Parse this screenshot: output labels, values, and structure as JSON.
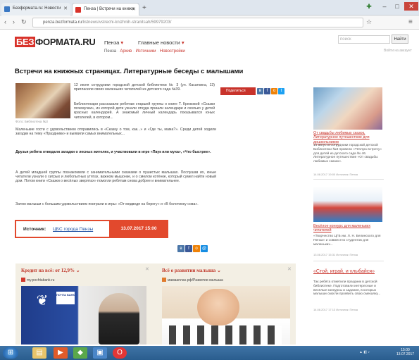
{
  "browser": {
    "tabs": [
      {
        "label": "Безформата.ru: Новости",
        "favicon_color": "#3a78c4"
      },
      {
        "label": "Пенза | Встречи на книжн",
        "favicon_color": "#d8322a"
      }
    ],
    "new_tab": "+",
    "address": {
      "domain": "penza.bezformata.ru",
      "path": "/listnews/vstrechi-knizhnih-stranitsah/59979203/"
    },
    "window_controls": {
      "minimize": "–",
      "maximize": "□",
      "close": "✕"
    }
  },
  "site": {
    "logo_red": "БЕЗ",
    "logo_rest": "ФОРМАТА.RU",
    "city": "Пенза",
    "main_news": "Главные новости",
    "search_placeholder": "поиск",
    "search_button": "Найти",
    "login": "Войти на аккаунт",
    "breadcrumbs": [
      "Пенза",
      "Архив",
      "Источники",
      "Новостройки"
    ]
  },
  "article": {
    "title": "Встречи на книжных страницах. Литературные беседы с малышами",
    "photo_caption": "Фото: Библиотека №3",
    "p1": "12 июля сотрудники городской детской библиотеки № 3 (ул. Касаткина, 13) пригласили своих маленьких читателей из детского сада №39.",
    "p2": "Библиотекари рассказали ребятам старшей группы о книге Т. Крюковой «Сказки почемучки», из которой дети узнали откуда пришли календари и сколько у детей красных календарей. А знакомый личный календарь показывался юных читателей, в котором...",
    "p3": "Маленькие гости с удовольствием отправились в «Сказку о том, как...» и «Где ты, мама?». Среди детей ходили загадки на тему «Праздники» и выявили самых внимательных...",
    "p4_bold": "Друзья ребята отведали загадки о лесных жителях, и участвовали в игре «Паук или муха», «Что быстрее».",
    "p5": "А детей младшей группы познакомили с занимательными сказками о пушистых малышах. Послушав их, юные читатели узнали о хитрых и любопытных утятах, важном мышонке, и о смелом котёнке, который сумел найти новый дом. Потом книги «Сказки о весёлых зверятах» помогли ребятам снова добрее и внимательнее.",
    "p6": "Затем малыши с большим удовольствием поиграли в игры: «От медведя на берегу» и «В болотинку сова».",
    "share_label": "Поделиться",
    "source_label": "Источник:",
    "source_link": "ЦБС города Пензы",
    "source_date": "13.07.2017  15:00"
  },
  "ads": [
    {
      "title": "Кредит на всё: от 12,9%",
      "source": "my.pochtabank.ru",
      "bank_label": "ПОЧТА БАНК"
    },
    {
      "title": "Всё о развитии малыша",
      "source": "мамааплан.рф/Развитие-малыша"
    }
  ],
  "sidebar": [
    {
      "link": "От свадьбы любимых сказок, Литературное путешествие для дошкольников",
      "text": "14 августа сотрудники городской детской Библиотеки №3 провели «Тёплую встречу» для детей из детского сада № 46. Литературное путешествие «От свадьбы любимых сказок».",
      "meta": "14.08.2017 19:00 Источник: Пенза"
    },
    {
      "link": "Весёлое конкурс для маленьких читателей",
      "text": "«Творчество ЦГБ им. Л. Н. Белинского для Пенза» и совместно студентов для маленьких...",
      "meta": "13.08.2017 15:31 Источник: Пенза"
    },
    {
      "link": "«Стой, играй, и улыбайся»",
      "text": "Так ребята отметили праздник в детской библиотеке. Подготовили интересные и весёлые конкурсы и задания, в которых малыши смогли проявить свою смекалку...",
      "meta": "14.08.2017 17:13 Источник: Пенза"
    }
  ],
  "taskbar": {
    "clock_time": "15:00",
    "clock_date": "13.07.2017"
  }
}
